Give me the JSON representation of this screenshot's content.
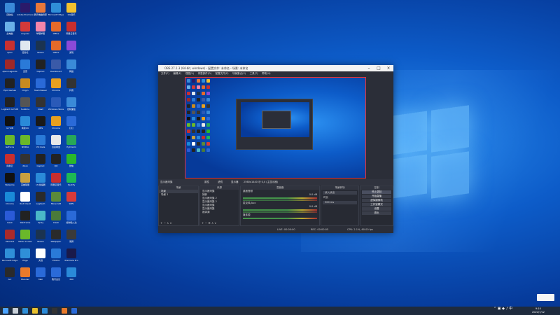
{
  "desktop_icons": [
    {
      "label": "回收站",
      "color": "#3a8ad8"
    },
    {
      "label": "Adobe Premiere",
      "color": "#2a1a6a"
    },
    {
      "label": "腾讯电脑管家",
      "color": "#e8783a"
    },
    {
      "label": "Microsoft Edge",
      "color": "#2f8fd8"
    },
    {
      "label": "QQ音乐",
      "color": "#f2c12e"
    },
    {
      "label": "此电脑",
      "color": "#6ab0e8"
    },
    {
      "label": "Angular",
      "color": "#d33a3a"
    },
    {
      "label": "哔哩哔哩",
      "color": "#f285aa"
    },
    {
      "label": "Office",
      "color": "#e66a2a"
    },
    {
      "label": "网易云音乐",
      "color": "#c82e2e"
    },
    {
      "label": "Apex",
      "color": "#c83030"
    },
    {
      "label": "任务栏",
      "color": "#dfe8f0"
    },
    {
      "label": "Steam",
      "color": "#1b3350"
    },
    {
      "label": "Office",
      "color": "#e66a2a"
    },
    {
      "label": "游戏",
      "color": "#8a4ad8"
    },
    {
      "label": "Apex Legends",
      "color": "#a02828"
    },
    {
      "label": "迅雷",
      "color": "#2a7ad8"
    },
    {
      "label": "CapCut",
      "color": "#222222"
    },
    {
      "label": "Dashboard",
      "color": "#3a5aa8"
    },
    {
      "label": "网络",
      "color": "#3a8ad8"
    },
    {
      "label": "Epic Games",
      "color": "#222222"
    },
    {
      "label": "Origin",
      "color": "#c88a20"
    },
    {
      "label": "TeamViewer",
      "color": "#2a6ad8"
    },
    {
      "label": "Chrome",
      "color": "#e8a020"
    },
    {
      "label": "抖音",
      "color": "#333333"
    },
    {
      "label": "Logitech G HUB",
      "color": "#222222"
    },
    {
      "label": "Sublime",
      "color": "#555555"
    },
    {
      "label": "Clash",
      "color": "#333333"
    },
    {
      "label": "Windows Store",
      "color": "#2a5ab8"
    },
    {
      "label": "控制面板",
      "color": "#3a8ad8"
    },
    {
      "label": "G HUB",
      "color": "#111111"
    },
    {
      "label": "网易UU",
      "color": "#2a8ad8"
    },
    {
      "label": "OBS",
      "color": "#1a1a1a"
    },
    {
      "label": "Chrome",
      "color": "#e8a020"
    },
    {
      "label": "钉钉",
      "color": "#2a6ad8"
    },
    {
      "label": "GeForce",
      "color": "#6ab82a"
    },
    {
      "label": "NVIDIA",
      "color": "#6ab82a"
    },
    {
      "label": "VS Code",
      "color": "#2a7ad8"
    },
    {
      "label": "百度网盘",
      "color": "#e8e8e8"
    },
    {
      "label": "PyCharm",
      "color": "#28a858"
    },
    {
      "label": "网易云",
      "color": "#c82e2e"
    },
    {
      "label": "Xbox",
      "color": "#333333"
    },
    {
      "label": "CapCut",
      "color": "#222222"
    },
    {
      "label": "QQ",
      "color": "#222222"
    },
    {
      "label": "微信",
      "color": "#2ab82a"
    },
    {
      "label": "WeGame",
      "color": "#111111"
    },
    {
      "label": "英雄联盟",
      "color": "#c8a040"
    },
    {
      "label": "UU加速器",
      "color": "#2a8ad8"
    },
    {
      "label": "网易云音乐",
      "color": "#c82e2e"
    },
    {
      "label": "Spotify",
      "color": "#1db954"
    },
    {
      "label": "Chrome",
      "color": "#1a8ad8"
    },
    {
      "label": "Riot Client",
      "color": "#ffffff"
    },
    {
      "label": "Logitech",
      "color": "#2a2a2a"
    },
    {
      "label": "Minecraft",
      "color": "#5a8a3a"
    },
    {
      "label": "WPS",
      "color": "#d83a3a"
    },
    {
      "label": "Geek",
      "color": "#2a5ad8"
    },
    {
      "label": "Warframe",
      "color": "#222222"
    },
    {
      "label": "Uplay",
      "color": "#4ab8c8"
    },
    {
      "label": "Clash",
      "color": "#4a7a3a"
    },
    {
      "label": "搜狗输入法",
      "color": "#2a6ad8"
    },
    {
      "label": "Valorant",
      "color": "#aa2a2a"
    },
    {
      "label": "Razer Cortex",
      "color": "#6ab82a"
    },
    {
      "label": "Steam",
      "color": "#1b3350"
    },
    {
      "label": "Wallpaper",
      "color": "#2a2a2a"
    },
    {
      "label": "录屏",
      "color": "#3a3a3a"
    },
    {
      "label": "Microsoft Edge",
      "color": "#2f8fd8"
    },
    {
      "label": "Edge",
      "color": "#2f8fd8"
    },
    {
      "label": "文档",
      "color": "#ffffff"
    },
    {
      "label": "Photos",
      "color": "#2a7ad8"
    },
    {
      "label": "Premiere Pro",
      "color": "#1a1a4a"
    },
    {
      "label": "Arc",
      "color": "#2a2a2a"
    },
    {
      "label": "Blender",
      "color": "#e87a2a"
    },
    {
      "label": "Mail",
      "color": "#2a6ad8"
    },
    {
      "label": "腾讯会议",
      "color": "#2a6ad8"
    },
    {
      "label": "360",
      "color": "#2a8ad8"
    }
  ],
  "obs": {
    "title": "OBS 27.1.3 (64-bit, windows) - 配置文件: 未命名 - 场景: 未命名",
    "menus": [
      "文件(F)",
      "编辑(E)",
      "视图(V)",
      "停靠部件(D)",
      "配置文件(P)",
      "场景集合(S)",
      "工具(T)",
      "帮助(H)"
    ],
    "scenebar": {
      "label": "显示器采集",
      "props": "属性",
      "filter": "滤镜",
      "display": "显示器",
      "display_value": "2560x1440 @ 0,0 (主显示器)"
    },
    "docks": {
      "scenes": {
        "title": "场景",
        "items": [
          "场景",
          "场景 2"
        ]
      },
      "sources": {
        "title": "来源",
        "items": [
          "显示器采集",
          "捕获",
          "显示器采集 2",
          "显示器采集 2",
          "显示器采集",
          "显示器采集",
          "媒体源"
        ]
      },
      "mixer": {
        "title": "混音器",
        "channels": [
          {
            "name": "桌面音频",
            "level": "0.0 dB"
          },
          {
            "name": "麦克风/Aux",
            "level": "0.0 dB"
          },
          {
            "name": "媒体源",
            "level": "0.0 dB"
          }
        ]
      },
      "transitions": {
        "title": "场景转场",
        "current": "淡入淡出",
        "duration_label": "时长",
        "duration": "300 ms"
      },
      "controls": {
        "title": "控制",
        "buttons": [
          "停止录制",
          "开始直播",
          "虚拟摄像机",
          "工作室模式",
          "设置",
          "退出"
        ]
      }
    },
    "status": {
      "live": "LIVE: 00:00:00",
      "rec": "REC: 00:00:05",
      "cpu": "CPU: 2.1%, 60.00 fps"
    }
  },
  "taskbar": {
    "time": "9:10",
    "date": "2022/7/12"
  }
}
